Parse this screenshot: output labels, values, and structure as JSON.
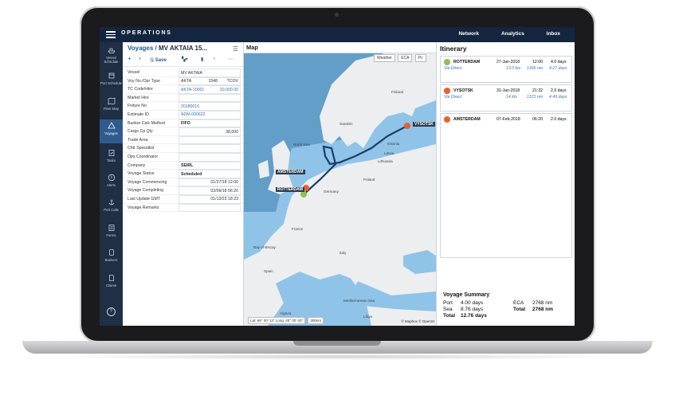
{
  "topbar": {
    "brand": "OPERATIONS",
    "nav": [
      "Network",
      "Analytics",
      "Inbox"
    ]
  },
  "sidebar": {
    "items": [
      {
        "label": "Vessel Schedule",
        "icon": "ship-icon"
      },
      {
        "label": "Port Schedule",
        "icon": "port-icon"
      },
      {
        "label": "Fleet Map",
        "icon": "map-icon"
      },
      {
        "label": "Voyages",
        "icon": "voyage-icon"
      },
      {
        "label": "Tasks",
        "icon": "tasks-icon"
      },
      {
        "label": "Alerts",
        "icon": "alert-icon"
      },
      {
        "label": "Port Calls",
        "icon": "anchor-icon"
      },
      {
        "label": "Forms",
        "icon": "forms-icon"
      },
      {
        "label": "Bunkers",
        "icon": "bunker-icon"
      },
      {
        "label": "Claims",
        "icon": "claims-icon"
      }
    ],
    "help": "?"
  },
  "voyage": {
    "title_prefix": "Voyages",
    "title_sep": "/",
    "title": "MV AKTAIA 15...",
    "save": "Save",
    "fields": [
      {
        "label": "Vessel",
        "value": "MV AKTAIA",
        "style": "plain",
        "align": "left"
      },
      {
        "label": "Voy No./Opr Type",
        "value": "AKTA",
        "value2": "1548",
        "value3": "TCOV",
        "style": "plain",
        "align": "split"
      },
      {
        "label": "TC Code/Hire",
        "value": "AKTA-10001",
        "value2": "20,000.00",
        "style": "blue",
        "align": "split2"
      },
      {
        "label": "Market Hire",
        "value": "",
        "style": "plain",
        "align": "left"
      },
      {
        "label": "Fixture No",
        "value": "20180016",
        "style": "blue",
        "align": "left"
      },
      {
        "label": "Estimate ID",
        "value": "ADM-000622",
        "style": "blue",
        "align": "left"
      },
      {
        "label": "Bunker Calc Method",
        "value": "FIFO",
        "style": "bold",
        "align": "left"
      },
      {
        "label": "Cargo Cp Qty",
        "value": "38,000",
        "style": "plain",
        "align": "right"
      },
      {
        "label": "Trade Area",
        "value": "",
        "style": "plain",
        "align": "left"
      },
      {
        "label": "Chtr Specialist",
        "value": "",
        "style": "plain",
        "align": "left"
      },
      {
        "label": "Ops Coordinator",
        "value": "",
        "style": "plain",
        "align": "left"
      },
      {
        "label": "Company",
        "value": "SEIRL",
        "style": "bold",
        "align": "left"
      },
      {
        "label": "Voyage Status",
        "value": "Scheduled",
        "style": "bold",
        "align": "left"
      },
      {
        "label": "Voyage Commencing",
        "value": "01/27/18 12:00",
        "style": "plain",
        "align": "right"
      },
      {
        "label": "Voyage Completing",
        "value": "02/09/18 06:20",
        "style": "plain",
        "align": "right"
      },
      {
        "label": "Last Update GMT",
        "value": "01/13/23 18:23",
        "style": "plain",
        "align": "right"
      },
      {
        "label": "Voyage Remarks",
        "value": "",
        "style": "plain",
        "align": "left"
      }
    ]
  },
  "map": {
    "title": "Map",
    "controls": [
      "Weather",
      "ECA",
      "Pc"
    ],
    "coords": "Lat: 66° 00' 13\"  Long: 45° 00' 00\"",
    "scale": "300nm",
    "credit": "© Mapbox © OpenSt",
    "labels": {
      "north_sea": "North Sea",
      "amsterdam": "AMSTERDAM",
      "rotterdam": "ROTTERDAM",
      "vysotsk": "VYSOTSK",
      "sweden": "Sweden",
      "finland": "Finland",
      "estonia": "Estonia",
      "latvia": "Latvia",
      "lithuania": "Lithuania",
      "poland": "Poland",
      "germany": "Germany",
      "france": "France",
      "spain": "Spain",
      "italy": "Italy",
      "algeria": "Algeria",
      "libya": "Libya",
      "bay": "Bay of Biscay",
      "med": "Mediterranean Sea"
    },
    "colors": {
      "sea": "#8fc3e8",
      "land": "#eceeef",
      "eca": "#3f7fae",
      "route": "#1c3d66"
    }
  },
  "itinerary": {
    "title": "Itinerary",
    "stops": [
      {
        "port": "ROTTERDAM",
        "date": "27-Jan-2018",
        "time": "12:00",
        "days": "4.0 days",
        "via": "Via Direct",
        "speed": "13.0 kts",
        "dist": "1396 nm",
        "sea_days": "4.27 days",
        "color": "#8bc34a"
      },
      {
        "port": "VYSOTSK",
        "date": "31-Jan-2018",
        "time": "21:32",
        "days": "2.0 days",
        "via": "Via Direct",
        "speed": "14 kts",
        "dist": "1372 nm",
        "sea_days": "4.49 days",
        "color": "#e8612c"
      },
      {
        "port": "AMSTERDAM",
        "date": "07-Feb-2018",
        "time": "06:20",
        "days": "2.0 days",
        "via": "",
        "speed": "",
        "dist": "",
        "sea_days": "",
        "color": "#e8612c"
      }
    ],
    "summary": {
      "title": "Voyage Summary",
      "port_label": "Port",
      "port_val": "4.00 days",
      "sea_label": "Sea",
      "sea_val": "8.76 days",
      "total_label": "Total",
      "total_val": "12.76 days",
      "eca_label": "ECA",
      "eca_val": "2768 nm",
      "total2_label": "Total",
      "total2_val": "2768 nm"
    }
  }
}
